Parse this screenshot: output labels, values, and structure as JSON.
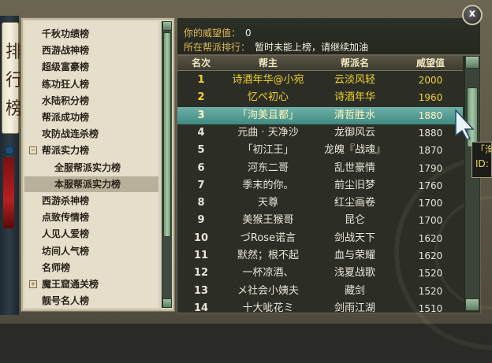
{
  "close_label": "x",
  "sidebar": {
    "scroll_text": "排行榜",
    "items": [
      {
        "label": "千秋功绩榜",
        "level": 0,
        "expander": ""
      },
      {
        "label": "西游战神榜",
        "level": 0,
        "expander": ""
      },
      {
        "label": "超级富豪榜",
        "level": 0,
        "expander": ""
      },
      {
        "label": "练功狂人榜",
        "level": 0,
        "expander": ""
      },
      {
        "label": "水陆积分榜",
        "level": 0,
        "expander": ""
      },
      {
        "label": "帮派成功榜",
        "level": 0,
        "expander": ""
      },
      {
        "label": "攻防战连杀榜",
        "level": 0,
        "expander": ""
      },
      {
        "label": "帮派实力榜",
        "level": 0,
        "expander": "−"
      },
      {
        "label": "全服帮派实力榜",
        "level": 1,
        "expander": ""
      },
      {
        "label": "本服帮派实力榜",
        "level": 1,
        "expander": "",
        "selected": true
      },
      {
        "label": "西游杀神榜",
        "level": 0,
        "expander": ""
      },
      {
        "label": "点致传情榜",
        "level": 0,
        "expander": ""
      },
      {
        "label": "人见人爱榜",
        "level": 0,
        "expander": ""
      },
      {
        "label": "坊间人气榜",
        "level": 0,
        "expander": ""
      },
      {
        "label": "名师榜",
        "level": 0,
        "expander": ""
      },
      {
        "label": "魔王窟通关榜",
        "level": 0,
        "expander": "+"
      },
      {
        "label": "靓号名人榜",
        "level": 0,
        "expander": ""
      }
    ]
  },
  "info": {
    "prestige_label": "你的威望值：",
    "prestige_value": "0",
    "rank_label": "所在帮派排行：",
    "rank_value": "暂时未能上榜，请继续加油"
  },
  "table": {
    "headers": {
      "rank": "名次",
      "leader": "帮主",
      "guild": "帮派名",
      "score": "威望值"
    },
    "rows": [
      {
        "rank": "1",
        "leader": "诗酒年华@小宛",
        "guild": "云淡风轻",
        "score": "2000",
        "style": "top"
      },
      {
        "rank": "2",
        "leader": "忆ぺ初心",
        "guild": "诗酒年华",
        "score": "1960",
        "style": "top"
      },
      {
        "rank": "3",
        "leader": "「洵美且都」",
        "guild": "清哲胜水",
        "score": "1880",
        "style": "sel"
      },
      {
        "rank": "4",
        "leader": "元曲 · 天净沙",
        "guild": "龙御风云",
        "score": "1880",
        "style": ""
      },
      {
        "rank": "5",
        "leader": "「初江王」",
        "guild": "龙魄『战魂』",
        "score": "1870",
        "style": ""
      },
      {
        "rank": "6",
        "leader": "河东二哥",
        "guild": "乱世豪情",
        "score": "1790",
        "style": ""
      },
      {
        "rank": "7",
        "leader": "季末的你。",
        "guild": "前尘旧梦",
        "score": "1760",
        "style": ""
      },
      {
        "rank": "8",
        "leader": "天尊",
        "guild": "红尘画卷",
        "score": "1700",
        "style": ""
      },
      {
        "rank": "9",
        "leader": "美猴王猴哥",
        "guild": "昆仑",
        "score": "1700",
        "style": ""
      },
      {
        "rank": "10",
        "leader": "づRose诺言",
        "guild": "剑战天下",
        "score": "1620",
        "style": ""
      },
      {
        "rank": "11",
        "leader": "默然；根不起",
        "guild": "血与荣耀",
        "score": "1620",
        "style": ""
      },
      {
        "rank": "12",
        "leader": "一杯凉酒、",
        "guild": "浅夏战歌",
        "score": "1520",
        "style": ""
      },
      {
        "rank": "13",
        "leader": "メ社会小姨夫",
        "guild": "藏剑",
        "score": "1520",
        "style": ""
      },
      {
        "rank": "14",
        "leader": "十大呲花ミ",
        "guild": "剑雨江湖",
        "score": "1510",
        "style": ""
      }
    ]
  },
  "tooltip": {
    "line1": "「洵",
    "line2": "ID:"
  },
  "colors": {
    "highlight": "#f1d233",
    "selected_row": "#4f9b93",
    "info_label": "#e2b956"
  }
}
